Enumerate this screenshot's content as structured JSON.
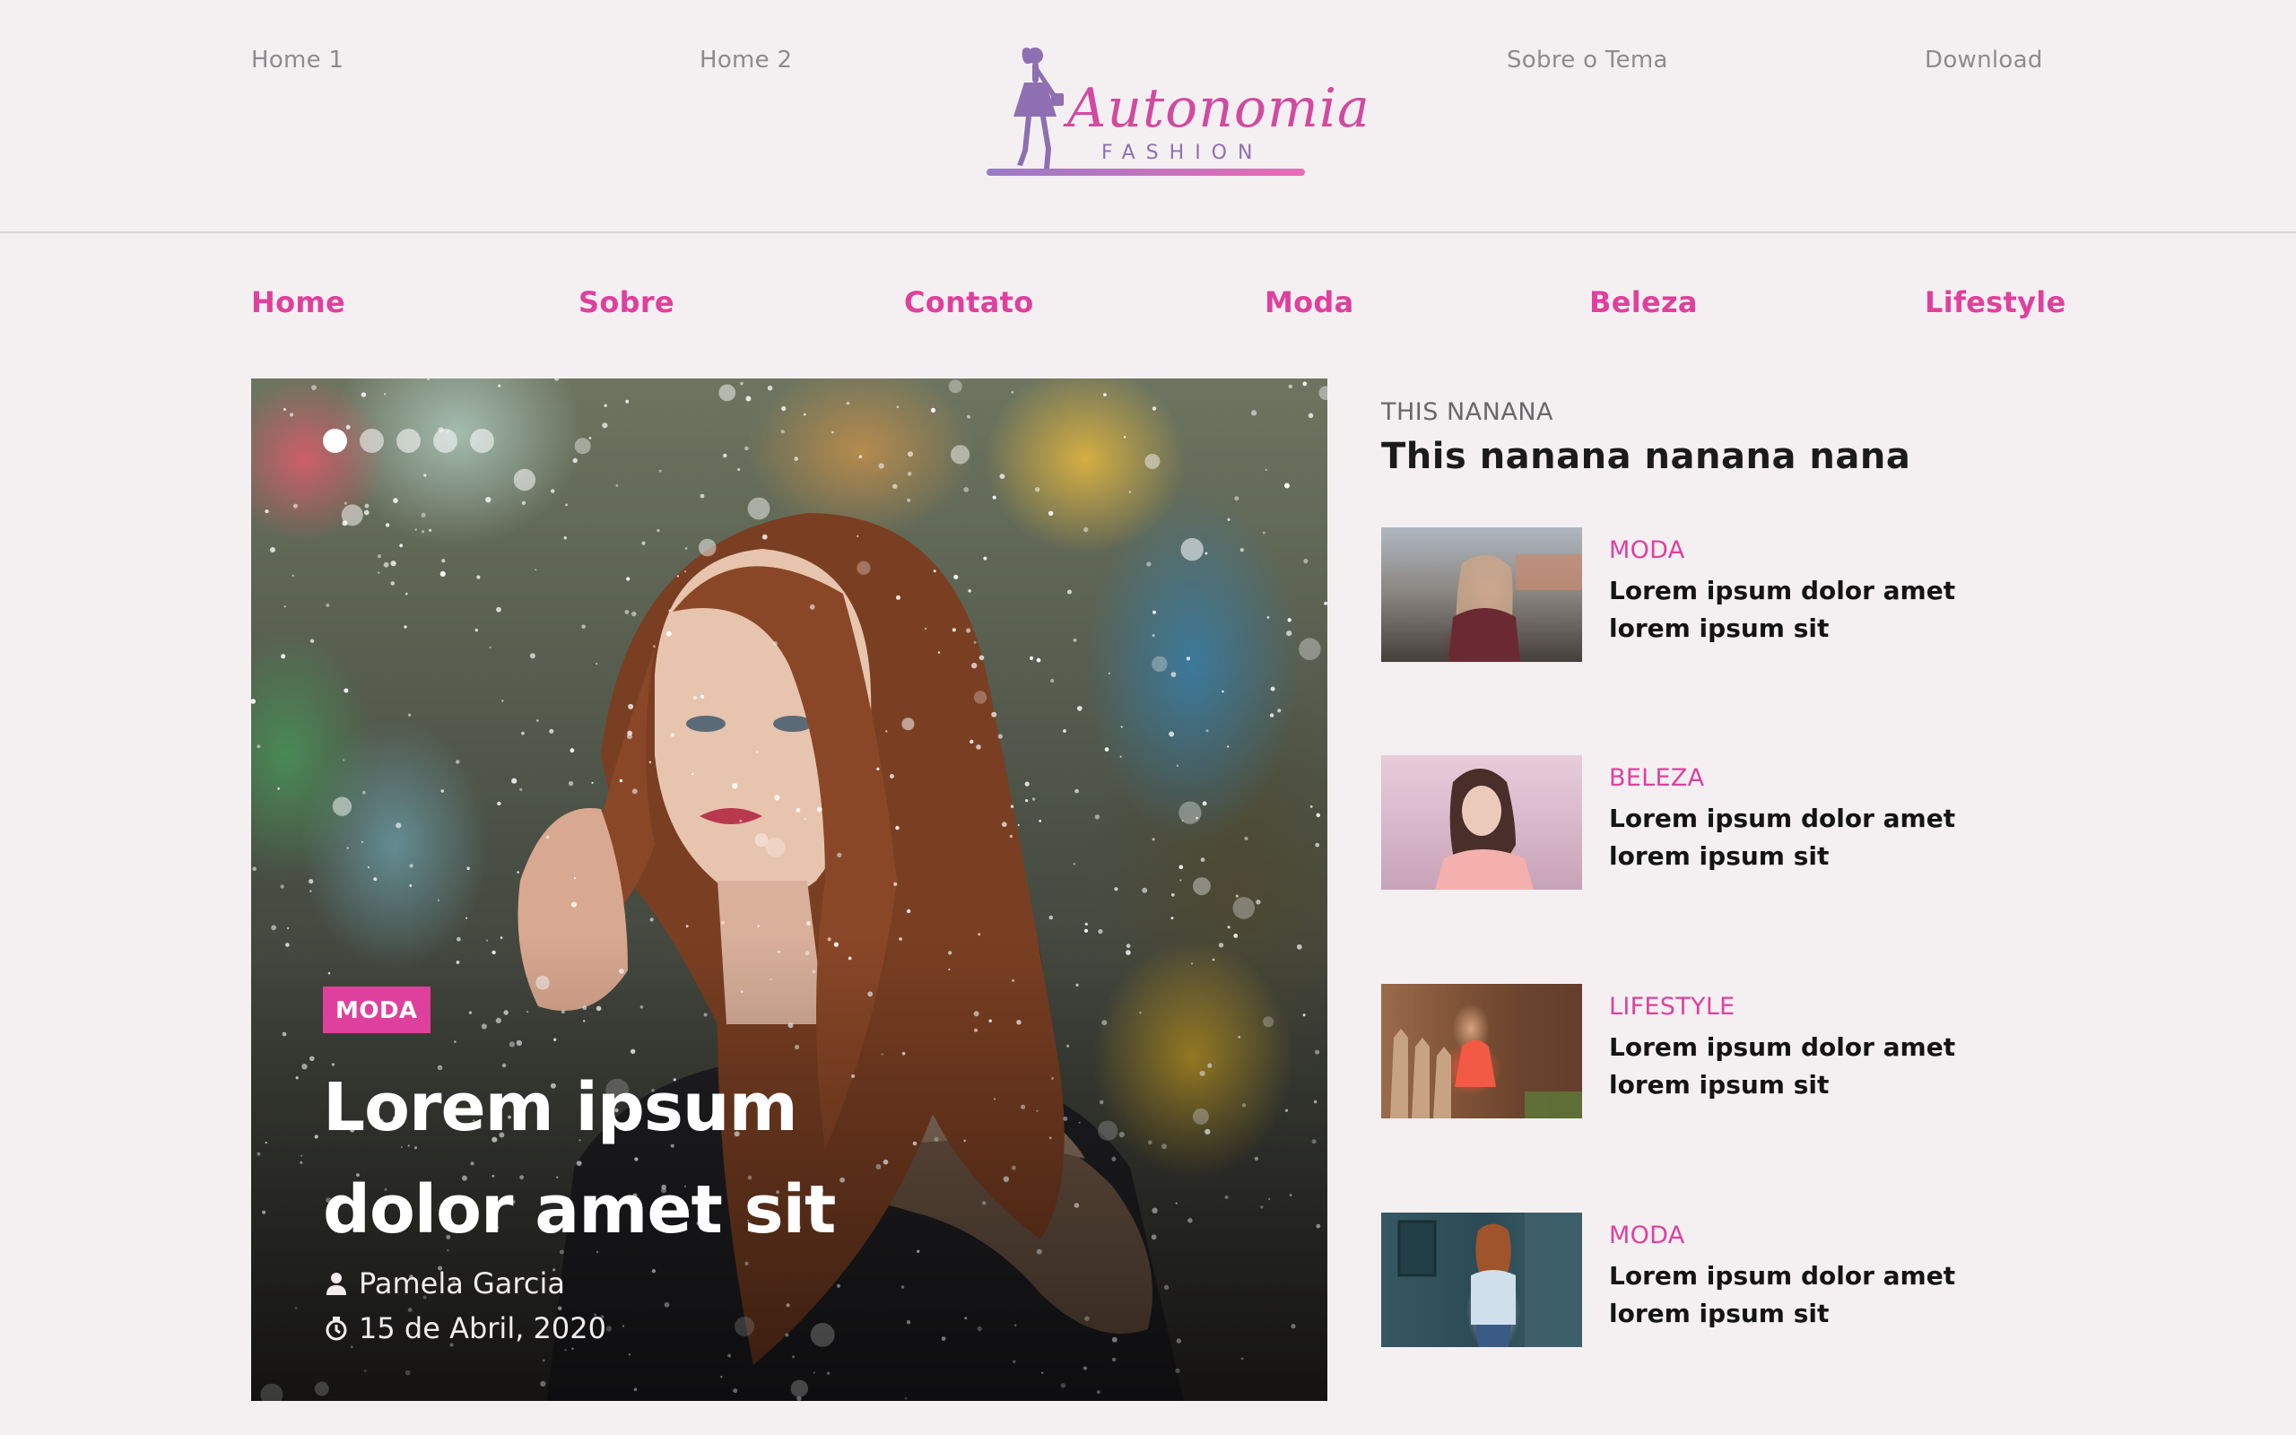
{
  "top_nav": {
    "links": [
      "Home 1",
      "Home 2",
      "Sobre o Tema",
      "Download"
    ]
  },
  "logo": {
    "name": "Autonomia",
    "tagline": "FASHION"
  },
  "main_nav": {
    "links": [
      "Home",
      "Sobre",
      "Contato",
      "Moda",
      "Beleza",
      "Lifestyle"
    ],
    "color": "#e0409d"
  },
  "hero": {
    "slide_count": 5,
    "active_slide": 1,
    "category": "MODA",
    "title": "Lorem ipsum dolor amet sit",
    "author": "Pamela Garcia",
    "date": "15 de Abril, 2020",
    "icons": {
      "author": "user-icon",
      "date": "clock-icon"
    }
  },
  "sidebar": {
    "kicker": "THIS NANANA",
    "heading": "This nanana nanana nana",
    "posts": [
      {
        "category": "MODA",
        "title": "Lorem ipsum dolor amet lorem ipsum sit"
      },
      {
        "category": "BELEZA",
        "title": "Lorem ipsum dolor amet lorem ipsum sit"
      },
      {
        "category": "LIFESTYLE",
        "title": "Lorem ipsum dolor amet lorem ipsum sit"
      },
      {
        "category": "MODA",
        "title": "Lorem ipsum dolor amet lorem ipsum sit"
      }
    ]
  },
  "colors": {
    "accent": "#e0409d",
    "background": "#f4f0f2",
    "logo_purple": "#8e6fb1"
  }
}
